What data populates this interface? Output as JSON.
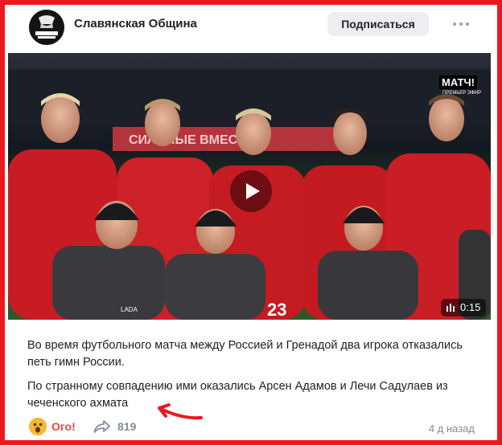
{
  "header": {
    "group_name": "Славянская Община",
    "subscribe_label": "Подписаться",
    "avatar_text": "СЛАВЯНСКАЯ ОБЩИНА"
  },
  "video": {
    "duration": "0:15",
    "channel_logo": "МАТЧ!",
    "channel_sub": "ПРЕМЬЕР ЭФИР",
    "banner_text": "СИЛЬНЫЕ ВМЕСТЕ",
    "jersey_number": "23",
    "shirt_brand": "LADA"
  },
  "post": {
    "paragraph1": "Во время футбольного матча между Россией и Гренадой два игрока отказались петь гимн России.",
    "paragraph2": "По странному совпадению ими оказались Арсен Адамов и Лечи Садулаев из чеченского ахмата"
  },
  "footer": {
    "reaction_label": "Ого!",
    "share_count": "819",
    "timestamp": "4 д назад"
  },
  "colors": {
    "frame": "#e8191f",
    "reaction": "#e64646",
    "muted": "#818c99",
    "button_bg": "#eceef1"
  },
  "icons": [
    "more-icon",
    "play-icon",
    "clip-icon",
    "surprised-emoji-icon",
    "share-icon",
    "red-arrow-annotation"
  ]
}
